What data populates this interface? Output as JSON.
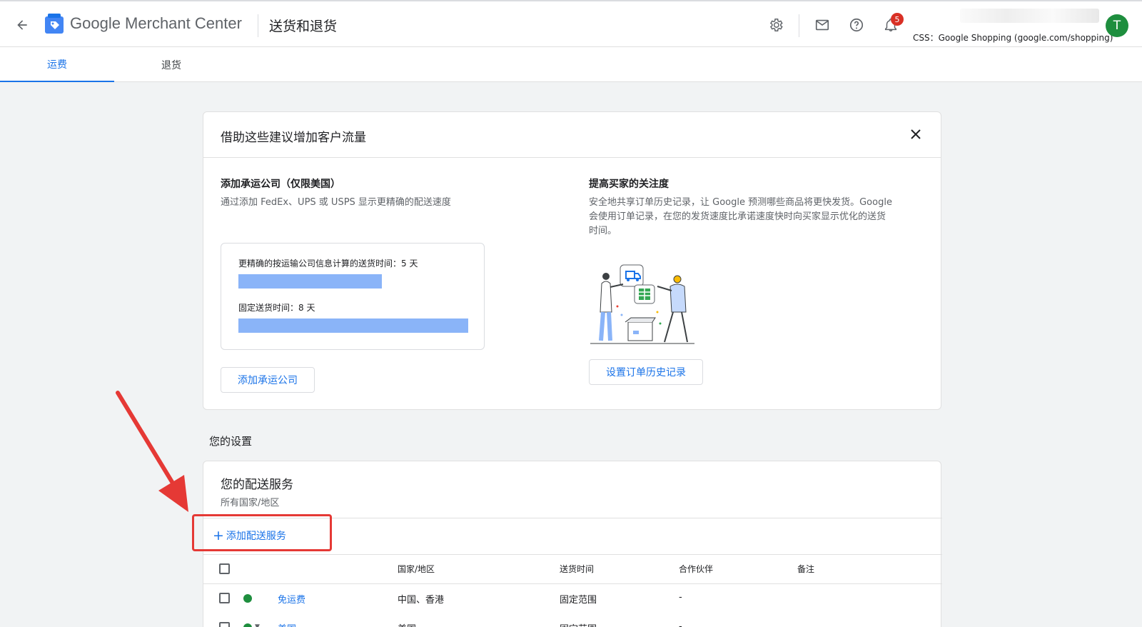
{
  "header": {
    "brand": "Google Merchant Center",
    "page_title": "送货和退货",
    "notification_count": "5",
    "account_css": "CSS：Google Shopping (google.com/shopping)",
    "avatar_initial": "T"
  },
  "tabs": [
    {
      "label": "运费",
      "active": true
    },
    {
      "label": "退货",
      "active": false
    }
  ],
  "suggestions": {
    "title": "借助这些建议增加客户流量",
    "carrier": {
      "title": "添加承运公司（仅限美国）",
      "desc": "通过添加 FedEx、UPS 或 USPS 显示更精确的配送速度",
      "accurate_label": "更精确的按运输公司信息计算的送货时间：5 天",
      "accurate_days": 5,
      "fixed_label": "固定送货时间：8 天",
      "fixed_days": 8,
      "button": "添加承运公司"
    },
    "buyer": {
      "title": "提高买家的关注度",
      "desc_lines": [
        "安全地共享订单历史记录，让 Google 预测哪些商品将更快发货。Google",
        "会使用订单记录，在您的发货速度比承诺速度快时向买家显示优化的送货",
        "时间。"
      ],
      "button": "设置订单历史记录"
    }
  },
  "settings_label": "您的设置",
  "services": {
    "title": "您的配送服务",
    "subtitle": "所有国家/地区",
    "add_button": "添加配送服务",
    "columns": [
      "国家/地区",
      "送货时间",
      "合作伙伴",
      "备注"
    ],
    "rows": [
      {
        "name": "免运费",
        "country": "中国、香港",
        "delivery": "固定范围",
        "partner": "-",
        "note": ""
      },
      {
        "name": "美国",
        "country": "美国",
        "delivery": "固定范围",
        "partner": "-",
        "note": ""
      }
    ]
  },
  "colors": {
    "accent": "#1a73e8",
    "bar": "#8ab4f8",
    "status_active": "#1e8e3e",
    "badge": "#d93025",
    "annotation": "#e53935"
  }
}
